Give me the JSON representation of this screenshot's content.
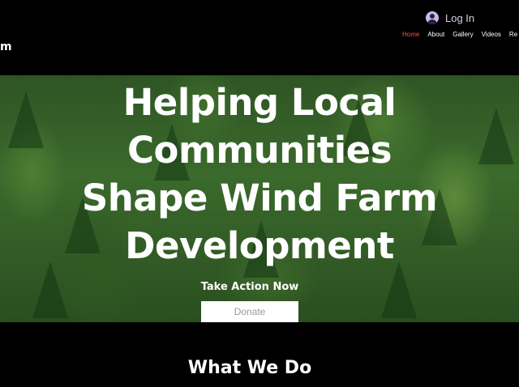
{
  "header": {
    "brand_fragment": "m",
    "login_label": "Log In",
    "nav": [
      {
        "label": "Home",
        "active": true
      },
      {
        "label": "About"
      },
      {
        "label": "Gallery"
      },
      {
        "label": "Videos"
      },
      {
        "label": "Re"
      }
    ]
  },
  "hero": {
    "title_lines": [
      "Helping Local",
      "Communities",
      "Shape Wind Farm",
      "Development"
    ],
    "subtitle": "Take Action Now",
    "donate_label": "Donate"
  },
  "section": {
    "title": "What We Do"
  },
  "colors": {
    "background": "#000000",
    "nav_active": "#f0573f",
    "text": "#ffffff"
  }
}
